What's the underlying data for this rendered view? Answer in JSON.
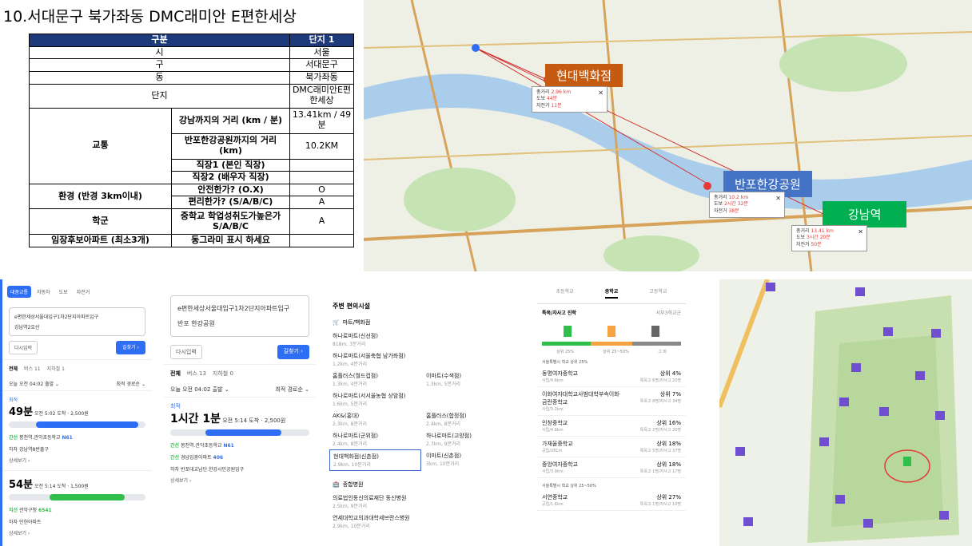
{
  "title": "10.서대문구 북가좌동 DMC래미안 E편한세상",
  "summary_table": {
    "header": [
      "구분",
      "단지 1"
    ],
    "city_label": "시",
    "city_value": "서울",
    "district_label": "구",
    "district_value": "서대문구",
    "dong_label": "동",
    "dong_value": "북가좌동",
    "complex_label": "단지",
    "complex_value": "DMC래미안E편한세상",
    "transport_label": "교통",
    "t1_label": "강남까지의 거리 (km / 분)",
    "t1_value": "13.41km / 49분",
    "t2_label": "반포한강공원까지의 거리 (km)",
    "t2_value": "10.2KM",
    "t3_label": "직장1 (본인 직장)",
    "t3_value": "",
    "t4_label": "직장2 (배우자 직장)",
    "t4_value": "",
    "env_label": "환경 (반경 3km이내)",
    "e1_label": "안전한가? (O.X)",
    "e1_value": "O",
    "e2_label": "편리한가? (S/A/B/C)",
    "e2_value": "A",
    "school_label": "학군",
    "s1_label": "중학교 학업성취도가높은가 S/A/B/C",
    "s1_value": "A",
    "near_label": "임장후보아파트 (최소3개)",
    "near_value": "동그라미 표시 하세요"
  },
  "map": {
    "label_hyundai": "현대백화점",
    "label_banpo": "반포한강공원",
    "label_gangnam": "강남역",
    "popup1": {
      "r1": "총거리",
      "v1": "2.96 km",
      "r2": "도보",
      "v2": "44분",
      "r3": "자전거",
      "v3": "11분"
    },
    "popup2": {
      "r1": "총거리",
      "v1": "10.2 km",
      "r2": "도보",
      "v2": "2시간 32분",
      "r3": "자전거",
      "v3": "38분"
    },
    "popup3": {
      "r1": "총거리",
      "v1": "13.41 km",
      "r2": "도보",
      "v2": "3시간 20분",
      "r3": "자전거",
      "v3": "50분"
    },
    "close": "✕"
  },
  "panel1": {
    "tabs": [
      "대중교통",
      "자동차",
      "도보",
      "자전거"
    ],
    "from": "e편한세상서울대입구1차2단지아파트입구",
    "to": "강남역2호선",
    "reset": "다시입력",
    "search": "길찾기 ›",
    "subtabs": [
      "전체",
      "버스 11",
      "지하철 1"
    ],
    "depart": "오늘 오전 04:02 출발 ⌄",
    "sort": "최적 경로순 ⌄",
    "r1_label": "최적",
    "r1_time": "49분",
    "r1_info": "오전 5:02 도착 · 2,500원",
    "r1_s1_type": "간선",
    "r1_s1_name": "봉천역.관악초등학교",
    "r1_s1_bus": "N61",
    "r1_s2_type": "하차",
    "r1_s2_name": "강남역8번출구",
    "more": "상세보기 ›",
    "r2_time": "54분",
    "r2_info": "오전 5:14 도착 · 1,500원",
    "r2_s1_type": "지선",
    "r2_s1_name": "관악구청",
    "r2_s1_bus": "6541",
    "r2_s2_type": "하차",
    "r2_s2_name": "인헌아파트"
  },
  "panel2": {
    "from": "e편한세상서울대입구1차2단지아파트입구",
    "to": "반포 한강공원",
    "reset": "다시입력",
    "search": "길찾기 ›",
    "subtabs": [
      "전체",
      "버스 13",
      "지하철 0"
    ],
    "depart": "오늘 오전 04:02 출발 ⌄",
    "sort": "최적 경로순 ⌄",
    "r1_label": "최적",
    "r1_time": "1시간 1분",
    "r1_info": "오전 5:14 도착 · 2,500원",
    "s1_type": "간선",
    "s1_name": "봉천역.관악초등학교",
    "s1_bus": "N61",
    "s2_type": "간선",
    "s2_name": "경남임광아파트",
    "s2_bus": "406",
    "s3_type": "하차",
    "s3_name": "반포대교남단.한강시민공원입구",
    "more": "상세보기 ›"
  },
  "panel3": {
    "header": "주변 편의시설",
    "sec1": "마트/백화점",
    "marts": [
      {
        "n": "하나로마트(신선점)",
        "d": "818m, 3분거리"
      },
      {
        "n": "",
        "d": ""
      },
      {
        "n": "하나로마트(서울축협 남가좌점)",
        "d": "1.2km, 4분거리"
      },
      {
        "n": "",
        "d": ""
      },
      {
        "n": "홈플러스(월드컵점)",
        "d": "1.3km, 4분거리"
      },
      {
        "n": "이마트(수색점)",
        "d": "1.3km, 5분거리"
      },
      {
        "n": "하나로마트(서서울농협 상암점)",
        "d": "1.6km, 5분거리"
      },
      {
        "n": "",
        "d": ""
      },
      {
        "n": "AK&(홍대)",
        "d": "2.3km, 8분거리"
      },
      {
        "n": "홈플러스(합정점)",
        "d": "2.4km, 8분거리"
      },
      {
        "n": "하나로마트(군위점)",
        "d": "2.4km, 8분거리"
      },
      {
        "n": "하나로마트(고양점)",
        "d": "2.7km, 9분거리"
      },
      {
        "n": "현대백화점(신촌점)",
        "d": "2.9km, 10분거리"
      },
      {
        "n": "이마트(신촌점)",
        "d": "3km, 10분거리"
      }
    ],
    "sec2": "종합병원",
    "hospitals": [
      {
        "n": "의료법인동신의료재단 동신병원",
        "d": "2.5km, 9분거리"
      },
      {
        "n": "연세대학교의과대학세브란스병원",
        "d": "2.9km, 10분거리"
      }
    ]
  },
  "panel4": {
    "tabs": [
      "초등학교",
      "중학교",
      "고등학교"
    ],
    "row_label": "특목/자사고 진학",
    "row_right": "서부3학교군",
    "scale_labels": [
      "상위 25%",
      "상위 25~50%",
      "그 외"
    ],
    "group1": "서울특별시 학교 상위 25%",
    "schools1": [
      {
        "nm": "동명여자중학교",
        "sb": "사립/4.6km",
        "rk": "상위 4%",
        "cnt": "특목고 6명/자사고 20명"
      },
      {
        "nm": "이화여자대학교사범대학부속이화·금란중학교",
        "sb": "사립/3.2km",
        "rk": "상위 7%",
        "cnt": "특목고 8명/자사고 34명"
      },
      {
        "nm": "인창중학교",
        "sb": "사립/4.8km",
        "rk": "상위 16%",
        "cnt": "특목고 2명/자사고 20명"
      },
      {
        "nm": "가재울중학교",
        "sb": "공립/281m",
        "rk": "상위 18%",
        "cnt": "특목고 5명/자사고 37명"
      },
      {
        "nm": "중앙여자중학교",
        "sb": "사립/3.9km",
        "rk": "상위 18%",
        "cnt": "특목고 1명/자사고 17명"
      }
    ],
    "group2": "서울특별시 학교 상위 25~50%",
    "schools2": [
      {
        "nm": "서연중학교",
        "sb": "공립/1.6km",
        "rk": "상위 27%",
        "cnt": "특목고 1명/자사고 10명"
      }
    ]
  },
  "colors": {
    "accent_blue": "#2e6ef5",
    "green": "#2fbf4a",
    "orange_label": "#c55a11",
    "blue_label": "#4472c4",
    "green_label": "#00b050",
    "header_blue": "#1f3a7a",
    "purple_marker": "#6f4fd0"
  },
  "icons": [
    "car-icon",
    "walk-icon",
    "bike-icon",
    "bus-icon",
    "cart-icon",
    "hospital-icon",
    "flag-icon",
    "close-icon",
    "swap-icon"
  ]
}
